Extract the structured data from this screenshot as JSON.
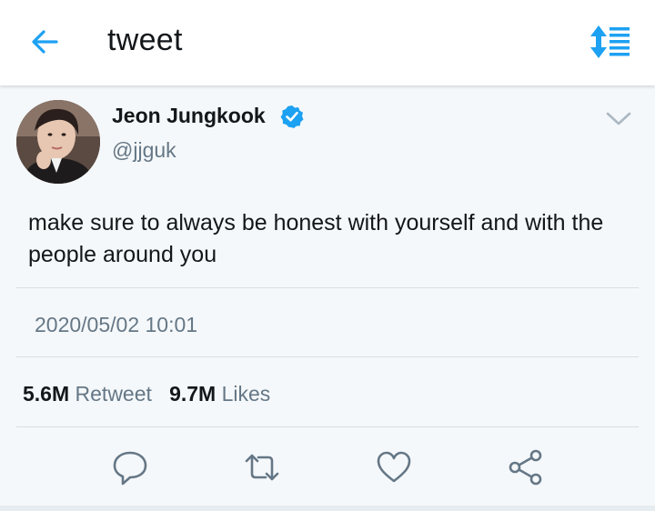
{
  "header": {
    "title": "tweet",
    "back_icon": "arrow-left-icon",
    "sort_icon": "sort-list-icon",
    "accent_color": "#1da1f2"
  },
  "tweet": {
    "author_name": "Jeon Jungkook",
    "handle": "@jjguk",
    "verified": true,
    "text": "make sure to always be honest with yourself and with the people around you",
    "timestamp": "2020/05/02 10:01",
    "retweet_count": "5.6M",
    "retweet_label": "Retweet",
    "like_count": "9.7M",
    "like_label": "Likes"
  },
  "actions": [
    {
      "name": "reply",
      "icon": "speech-bubble-icon"
    },
    {
      "name": "retweet",
      "icon": "retweet-icon"
    },
    {
      "name": "like",
      "icon": "heart-icon"
    },
    {
      "name": "share",
      "icon": "share-icon"
    }
  ],
  "colors": {
    "text_primary": "#14171a",
    "text_secondary": "#657786",
    "verified_badge": "#1da1f2",
    "background": "#f5f8fa"
  }
}
